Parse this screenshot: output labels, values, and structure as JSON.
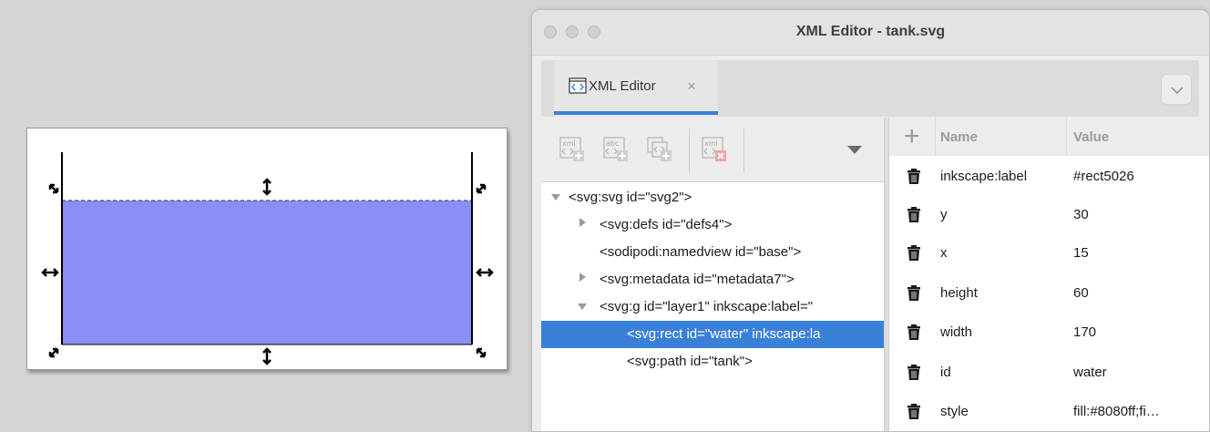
{
  "window": {
    "title": "XML Editor - tank.svg"
  },
  "tab": {
    "label": "XML Editor",
    "close": "×"
  },
  "toolbar": {
    "new_element_icon": "new-element-node-icon",
    "new_text_icon": "new-text-node-icon",
    "duplicate_icon": "duplicate-node-icon",
    "delete_icon": "delete-node-icon",
    "xml_glyph": "xml",
    "abc_glyph": "abc"
  },
  "tree": {
    "nodes": [
      {
        "text": "<svg:svg id=\"svg2\">",
        "toggle": "expanded"
      },
      {
        "text": "<svg:defs id=\"defs4\">",
        "toggle": "collapsed"
      },
      {
        "text": "<sodipodi:namedview id=\"base\">",
        "toggle": "none"
      },
      {
        "text": "<svg:metadata id=\"metadata7\">",
        "toggle": "collapsed"
      },
      {
        "text": "<svg:g id=\"layer1\" inkscape:label=\"",
        "toggle": "expanded"
      },
      {
        "text": "<svg:rect id=\"water\" inkscape:la",
        "toggle": "none",
        "selected": true
      },
      {
        "text": "<svg:path id=\"tank\">",
        "toggle": "none"
      }
    ]
  },
  "attributes": {
    "add_symbol": "+",
    "headers": {
      "name": "Name",
      "value": "Value"
    },
    "rows": [
      {
        "name": "inkscape:label",
        "value": "#rect5026"
      },
      {
        "name": "y",
        "value": "30"
      },
      {
        "name": "x",
        "value": "15"
      },
      {
        "name": "height",
        "value": "60"
      },
      {
        "name": "width",
        "value": "170"
      },
      {
        "name": "id",
        "value": "water"
      },
      {
        "name": "style",
        "value": "fill:#8080ff;fi…"
      }
    ]
  },
  "colors": {
    "water_fill": "#8b8ef5",
    "selection_blue": "#3a80d9",
    "tab_underline": "#3a80d9"
  }
}
